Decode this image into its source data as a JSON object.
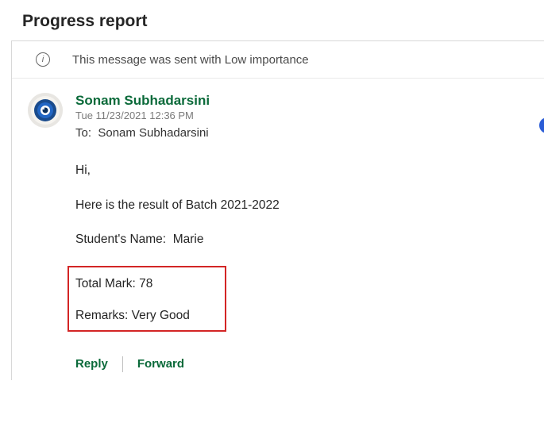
{
  "page": {
    "title": "Progress report"
  },
  "banner": {
    "text": "This message was sent with Low importance"
  },
  "email": {
    "sender": "Sonam Subhadarsini",
    "timestamp": "Tue 11/23/2021 12:36 PM",
    "to_label": "To:",
    "to_recipient": "Sonam Subhadarsini",
    "greeting": "Hi,",
    "intro": "Here is the result of Batch 2021-2022",
    "student_label": "Student's Name:",
    "student_value": "Marie",
    "total_label": "Total Mark:",
    "total_value": "78",
    "remarks_label": "Remarks:",
    "remarks_value": "Very Good"
  },
  "actions": {
    "reply": "Reply",
    "forward": "Forward"
  }
}
